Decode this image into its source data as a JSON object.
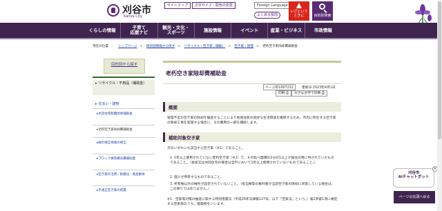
{
  "header": {
    "logo_name": "刈谷市",
    "logo_sub": "Kariya City",
    "util_links": [
      "サイトマップ",
      "文字サイズ・配色の変更",
      "Foreign Language"
    ],
    "faq_label": "よくある質問",
    "emergency_label": "いざという\nときに",
    "search_label": "目的別検索"
  },
  "nav": {
    "items": [
      "くらしの情報",
      "子育て\n応援ナビ",
      "観光・文化・\nスポーツ",
      "施設情報",
      "イベント",
      "産業・ビジネス",
      "市政情報"
    ]
  },
  "breadcrumb": {
    "current_label": "現在の位置",
    "links": [
      "トップページ",
      "目的別情報から探す",
      "リサイクル・空き家（補助）",
      "空き家・管理"
    ],
    "current": "老朽空き家除却費補助金"
  },
  "sidebar": {
    "header": "目的別から探す",
    "items": [
      "リサイクル・不用品（補助金）",
      "住まい・建物",
      "木造住宅耐震改修補助金",
      "老朽空き家除却費補助金",
      "緑の保全地域の保全",
      "ブロック塀等撤去費補助金",
      "空き家の活用・耐震化・家屋解体",
      "不適正空き家の把握"
    ]
  },
  "main": {
    "title": "老朽空き家除却費補助金",
    "page_id": "ページID1007232",
    "updated": "更新日 2023年4月1日",
    "print_label": "印刷",
    "large_print_label": "大きな文字で印刷",
    "sections": [
      {
        "heading": "概要",
        "body": "管理不全の空き家の除却を推進することにより地域住民の良好な生活環境を確保するため、市内に所在する空き家の除却工事を実施する場合に、その費用の一部を補助します。"
      },
      {
        "heading": "補助対象空き家",
        "intro": "次のいずれにも該当する空き家（※1）であること。",
        "list": [
          "1. 1年以上使用されていない老朽空き家（※2）で、その延べ面積の2分の1以上が居住の用に供されていたものであること。（長屋又は共同住宅の場合は全戸において1年以上使用されていないものであること。）",
          "2. 個人が所有するものであること。",
          "3. 所有権以外の権利が設定されていないこと。（抵当権等の権利者が当該空き家の除却に同意している場合は、この限りではありません。）"
        ],
        "note": "※1　空家等対策の推進に関する特別措置法（平成26年法律第127号。以下「空家法」という。）第2条第1項に規定する空家等のうち、建築物をいいます。"
      }
    ]
  },
  "floating": {
    "ai_label": "刈谷市\nAIチャットボット",
    "totop_label": "ページの先頭へ戻る"
  },
  "colors": {
    "nav_bg": "#3f2450",
    "accent": "#5a2a73",
    "emergency": "#d9261c",
    "section_bg": "#eceedd",
    "link": "#1a3fa3"
  }
}
